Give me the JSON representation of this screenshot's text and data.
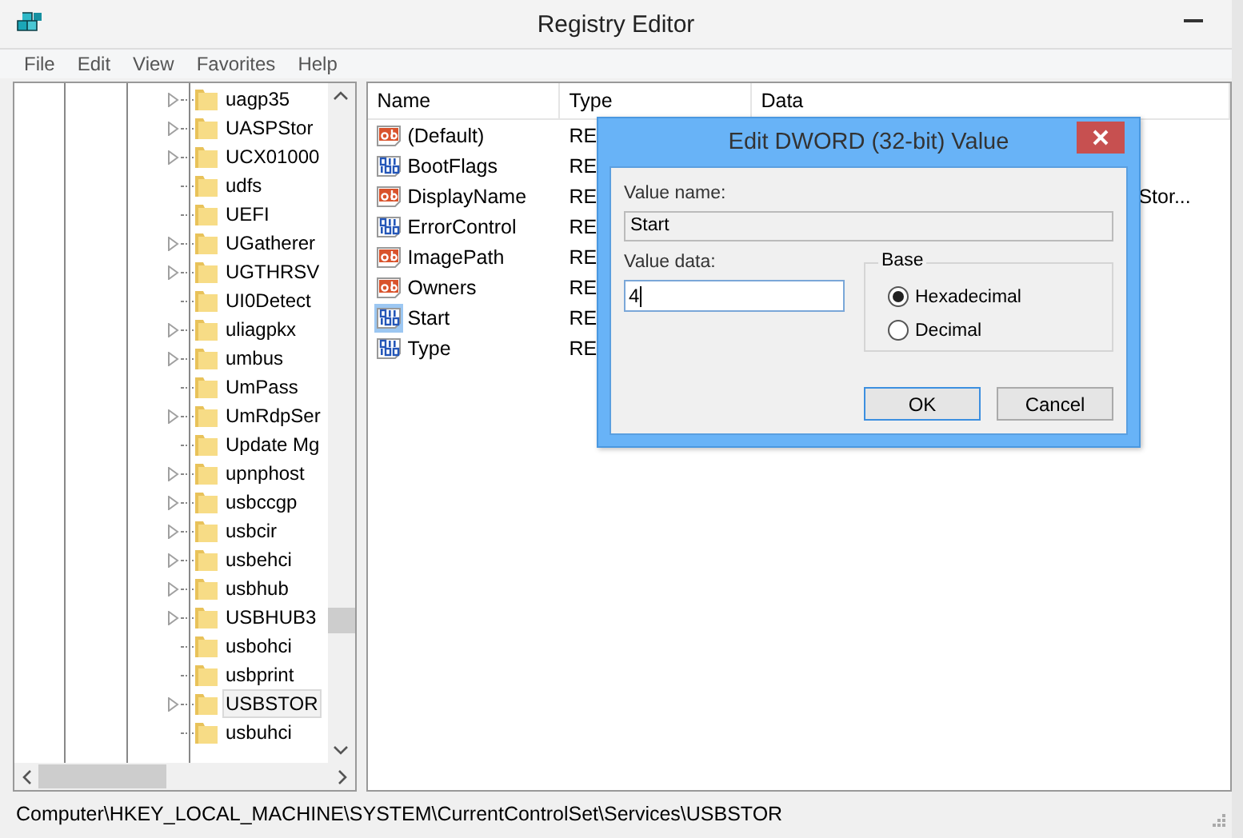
{
  "window": {
    "title": "Registry Editor"
  },
  "menu": [
    "File",
    "Edit",
    "View",
    "Favorites",
    "Help"
  ],
  "tree": {
    "items": [
      {
        "label": "uagp35",
        "expandable": true,
        "selected": false
      },
      {
        "label": "UASPStor",
        "expandable": true,
        "selected": false
      },
      {
        "label": "UCX01000",
        "expandable": true,
        "selected": false
      },
      {
        "label": "udfs",
        "expandable": false,
        "selected": false
      },
      {
        "label": "UEFI",
        "expandable": false,
        "selected": false
      },
      {
        "label": "UGatherer",
        "expandable": true,
        "selected": false
      },
      {
        "label": "UGTHRSV",
        "expandable": true,
        "selected": false
      },
      {
        "label": "UI0Detect",
        "expandable": false,
        "selected": false
      },
      {
        "label": "uliagpkx",
        "expandable": true,
        "selected": false
      },
      {
        "label": "umbus",
        "expandable": true,
        "selected": false
      },
      {
        "label": "UmPass",
        "expandable": false,
        "selected": false
      },
      {
        "label": "UmRdpSer",
        "expandable": true,
        "selected": false
      },
      {
        "label": "Update Mg",
        "expandable": false,
        "selected": false
      },
      {
        "label": "upnphost",
        "expandable": true,
        "selected": false
      },
      {
        "label": "usbccgp",
        "expandable": true,
        "selected": false
      },
      {
        "label": "usbcir",
        "expandable": true,
        "selected": false
      },
      {
        "label": "usbehci",
        "expandable": true,
        "selected": false
      },
      {
        "label": "usbhub",
        "expandable": true,
        "selected": false
      },
      {
        "label": "USBHUB3",
        "expandable": true,
        "selected": false
      },
      {
        "label": "usbohci",
        "expandable": false,
        "selected": false
      },
      {
        "label": "usbprint",
        "expandable": false,
        "selected": false
      },
      {
        "label": "USBSTOR",
        "expandable": true,
        "selected": true
      },
      {
        "label": "usbuhci",
        "expandable": false,
        "selected": false
      }
    ]
  },
  "values": {
    "columns": [
      "Name",
      "Type",
      "Data"
    ],
    "rows": [
      {
        "name": "(Default)",
        "kind": "string",
        "type": "RE",
        "selected": false
      },
      {
        "name": "BootFlags",
        "kind": "dword",
        "type": "RE",
        "selected": false
      },
      {
        "name": "DisplayName",
        "kind": "string",
        "type": "RE",
        "data": "Stor...",
        "selected": false
      },
      {
        "name": "ErrorControl",
        "kind": "dword",
        "type": "RE",
        "selected": false
      },
      {
        "name": "ImagePath",
        "kind": "string",
        "type": "RE",
        "selected": false
      },
      {
        "name": "Owners",
        "kind": "string",
        "type": "RE",
        "selected": false
      },
      {
        "name": "Start",
        "kind": "dword",
        "type": "RE",
        "selected": true
      },
      {
        "name": "Type",
        "kind": "dword",
        "type": "RE",
        "selected": false
      }
    ]
  },
  "dialog": {
    "title": "Edit DWORD (32-bit) Value",
    "value_name_label": "Value name:",
    "value_name": "Start",
    "value_data_label": "Value data:",
    "value_data": "4",
    "base_label": "Base",
    "base_options": [
      {
        "label": "Hexadecimal",
        "selected": true
      },
      {
        "label": "Decimal",
        "selected": false
      }
    ],
    "buttons": [
      "OK",
      "Cancel"
    ]
  },
  "status_bar": "Computer\\HKEY_LOCAL_MACHINE\\SYSTEM\\CurrentControlSet\\Services\\USBSTOR"
}
